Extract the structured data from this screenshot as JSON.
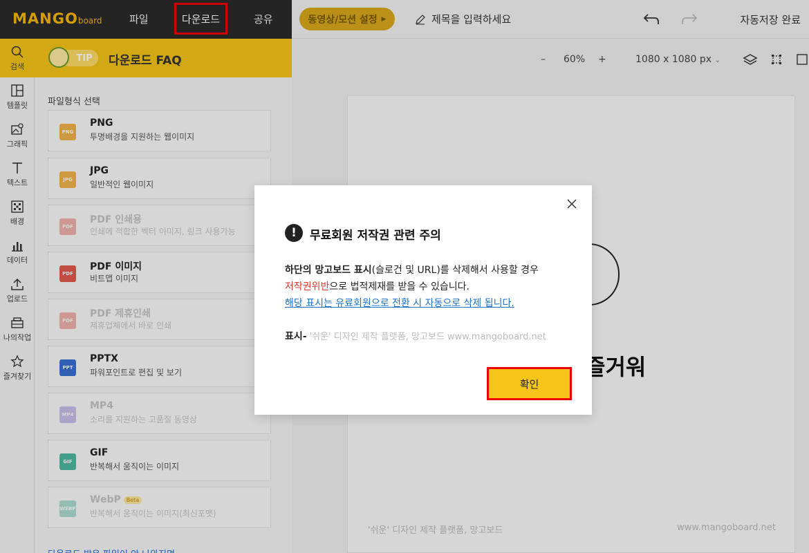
{
  "header": {
    "logo_main": "MANGO",
    "logo_sub": "board",
    "nav": {
      "file": "파일",
      "download": "다운로드",
      "share": "공유"
    },
    "motion_button": "동영상/모션 설정",
    "title_placeholder": "제목을 입력하세요",
    "autosave_status": "자동저장 완료"
  },
  "rail": {
    "items": [
      {
        "label": "검색"
      },
      {
        "label": "템플릿"
      },
      {
        "label": "그래픽"
      },
      {
        "label": "텍스트"
      },
      {
        "label": "배경"
      },
      {
        "label": "데이터"
      },
      {
        "label": "업로드"
      },
      {
        "label": "나의작업"
      },
      {
        "label": "즐겨찾기"
      }
    ]
  },
  "panel": {
    "tip_badge": "TIP",
    "tip_text": "다운로드 FAQ",
    "section_label": "파일형식 선택",
    "files": [
      {
        "title": "PNG",
        "desc": "투명배경을 지원하는 웹이미지",
        "icon": "PNG"
      },
      {
        "title": "JPG",
        "desc": "일반적인 웹이미지",
        "icon": "JPG"
      },
      {
        "title": "PDF 인쇄용",
        "desc": "인쇄에 적합한 벡터 이미지, 링크 사용가능",
        "icon": "PDF"
      },
      {
        "title": "PDF 이미지",
        "desc": "비트맵 이미지",
        "icon": "PDF"
      },
      {
        "title": "PDF 제휴인쇄",
        "desc": "제휴업체에서 바로 인쇄",
        "icon": "PDF"
      },
      {
        "title": "PPTX",
        "desc": "파워포인트로 편집 및 보기",
        "icon": "PPT"
      },
      {
        "title": "MP4",
        "desc": "소리를 지원하는 고품질 동영상",
        "icon": "MP4"
      },
      {
        "title": "GIF",
        "desc": "반복해서 움직이는 이미지",
        "icon": "GIF"
      },
      {
        "title": "WebP",
        "desc": "반복해서 움직이는 이미지(최신포맷)",
        "icon": "WEBP",
        "badge": "Beta"
      }
    ],
    "bottom_link": "다운로드 받은 파일이 안 나와지면"
  },
  "canvas": {
    "zoom_minus": "–",
    "zoom_level": "60%",
    "zoom_plus": "+",
    "size": "1080 x 1080 px",
    "main_text": "즐거워",
    "footer_left": "'쉬운' 디자인 제작 플랫폼, 망고보드",
    "footer_right": "www.mangoboard.net"
  },
  "modal": {
    "title": "무료회원 저작권 관련 주의",
    "line1_bold": "하단의 망고보드 표시",
    "line1_rest": "(슬로건 및 URL)를 삭제해서 사용할 경우",
    "line2_red": "저작권위반",
    "line2_rest": "으로 법적제재를 받을 수 있습니다.",
    "line3_link": "해당 표시는 유료회원으로 전환 시 자동으로 삭제 됩니다.",
    "mark_label": "표시-",
    "mark_text": "'쉬운' 디자인 제작 플랫폼, 망고보드  www.mangoboard.net",
    "confirm": "확인"
  },
  "colors": {
    "accent_yellow": "#f5c518",
    "header_dark": "#2b2b2b",
    "highlight_red": "#e00000",
    "link_blue": "#1c73c8",
    "warning_red": "#e53b2d"
  }
}
